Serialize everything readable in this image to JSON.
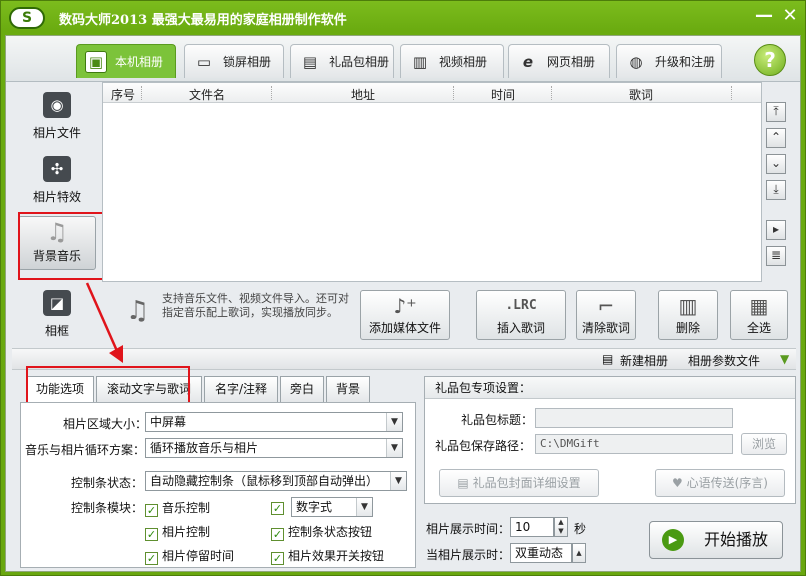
{
  "app": {
    "title": "数码大师2013    最强大最易用的家庭相册制作软件",
    "logo_letter": "S"
  },
  "window_controls": {
    "minimize": "—",
    "close": "✕"
  },
  "tabs": [
    {
      "label": "本机相册",
      "icon": "photo-album-icon"
    },
    {
      "label": "锁屏相册",
      "icon": "monitor-icon"
    },
    {
      "label": "礼品包相册",
      "icon": "gift-icon"
    },
    {
      "label": "视频相册",
      "icon": "film-icon"
    },
    {
      "label": "网页相册",
      "icon": "ie-icon"
    },
    {
      "label": "升级和注册",
      "icon": "globe-icon"
    }
  ],
  "help_label": "?",
  "leftnav": [
    {
      "label": "相片文件",
      "icon": "camera-icon"
    },
    {
      "label": "相片特效",
      "icon": "effects-icon"
    },
    {
      "label": "背景音乐",
      "icon": "music-note-icon"
    },
    {
      "label": "相框",
      "icon": "frame-icon"
    }
  ],
  "list": {
    "columns": [
      "序号",
      "文件名",
      "地址",
      "时间",
      "歌词"
    ]
  },
  "scroll_buttons": [
    "top-icon",
    "up-icon",
    "down-icon",
    "bottom-icon",
    "play-small-icon",
    "doc-icon"
  ],
  "toolbar": {
    "hint": "支持音乐文件、视频文件导入。还可对指定音乐配上歌词，实现播放同步。",
    "buttons": [
      {
        "label": "添加媒体文件",
        "icon": "add-media-icon"
      },
      {
        "label": "插入歌词",
        "icon": "lrc-icon"
      },
      {
        "label": "清除歌词",
        "icon": "eraser-icon"
      },
      {
        "label": "删除",
        "icon": "trash-icon"
      },
      {
        "label": "全选",
        "icon": "select-all-icon"
      }
    ]
  },
  "subbar": {
    "new_album": "新建相册",
    "album_params": "相册参数文件"
  },
  "lower_tabs": [
    "功能选项",
    "滚动文字与歌词",
    "名字/注释",
    "旁白",
    "背景"
  ],
  "options": {
    "area_size_label": "相片区域大小：",
    "area_size_value": "中屏幕",
    "loop_label": "音乐与相片循环方案：",
    "loop_value": "循环播放音乐与相片",
    "control_state_label": "控制条状态：",
    "control_state_value": "自动隐藏控制条（鼠标移到顶部自动弹出）",
    "control_module_label": "控制条模块：",
    "checks": [
      {
        "label": "音乐控制",
        "checked": true
      },
      {
        "label": "数字式",
        "checked": true,
        "is_select": true
      },
      {
        "label": "相片控制",
        "checked": true
      },
      {
        "label": "控制条状态按钮",
        "checked": true
      },
      {
        "label": "相片停留时间",
        "checked": true
      },
      {
        "label": "相片效果开关按钮",
        "checked": true
      }
    ]
  },
  "gift": {
    "header": "礼品包专项设置：",
    "title_label": "礼品包标题：",
    "title_value": "",
    "path_label": "礼品包保存路径：",
    "path_value": "C:\\DMGift",
    "browse": "浏览",
    "cover_btn": "礼品包封面详细设置",
    "message_btn": "心语传送(序言)"
  },
  "playback": {
    "show_time_label": "相片展示时间：",
    "show_time_value": "10",
    "show_time_unit": "秒",
    "current_show_label": "当相片展示时：",
    "current_show_value": "双重动态",
    "start_btn": "开始播放"
  },
  "colors": {
    "accent_green": "#6aab10",
    "highlight_red": "#e0141b"
  }
}
